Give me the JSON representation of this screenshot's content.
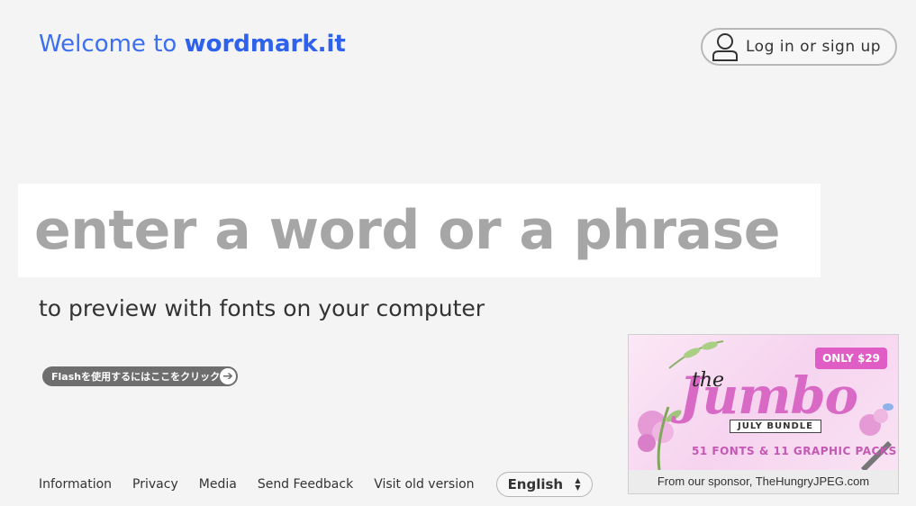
{
  "header": {
    "welcome_prefix": "Welcome to ",
    "brand": "wordmark.it",
    "login_label": "Log in or sign up"
  },
  "main": {
    "phrase_placeholder": "enter a word or a phrase",
    "subtitle": "to preview with fonts on your computer",
    "flash_label": "Flashを使用するにはここをクリック"
  },
  "footer": {
    "links": [
      "Information",
      "Privacy",
      "Media",
      "Send Feedback",
      "Visit old version"
    ],
    "language": "English"
  },
  "sponsor": {
    "price": "ONLY $29",
    "title_small": "the",
    "title": "Jumbo",
    "subtitle": "JULY BUNDLE",
    "description": "51 FONTS & 11 GRAPHIC PACKS",
    "caption": "From our sponsor, TheHungryJPEG.com"
  },
  "colors": {
    "accent": "#3b6ef0",
    "background": "#f4f4f4",
    "placeholder": "#a6a6a6"
  }
}
